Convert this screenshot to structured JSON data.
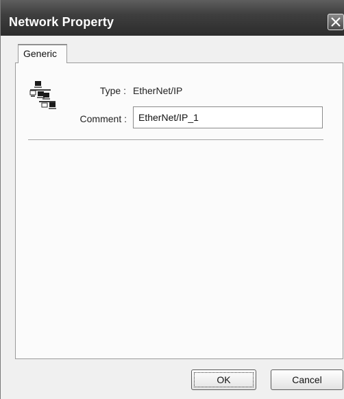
{
  "window": {
    "title": "Network Property"
  },
  "tabs": [
    {
      "label": "Generic"
    }
  ],
  "form": {
    "type_label": "Type :",
    "type_value": "EtherNet/IP",
    "comment_label": "Comment :",
    "comment_value": "EtherNet/IP_1"
  },
  "buttons": {
    "ok": "OK",
    "cancel": "Cancel"
  },
  "icons": {
    "network": "network-topology-icon",
    "close": "close-icon"
  }
}
